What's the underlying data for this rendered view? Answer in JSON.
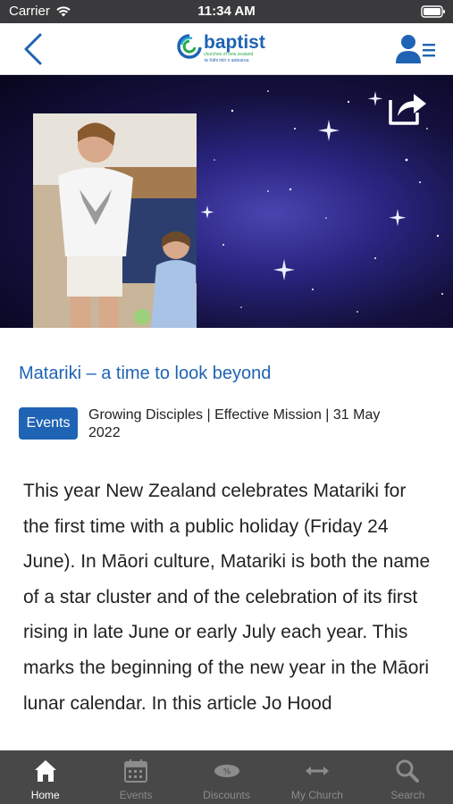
{
  "status_bar": {
    "carrier": "Carrier",
    "time": "11:34 AM",
    "icons": [
      "wifi-icon",
      "battery-icon"
    ]
  },
  "nav": {
    "back_icon": "chevron-left-icon",
    "logo_text": "baptist",
    "logo_subtext": "churches of new zealand",
    "logo_tagline": "te hāhi iriiri o aotearoa",
    "profile_icon": "profile-menu-icon",
    "accent_color": "#1f63b4"
  },
  "hero": {
    "share_icon": "share-icon",
    "photo_icon": "hero-photo"
  },
  "article": {
    "title": "Matariki – a time to look beyond",
    "category": "Events",
    "meta": "Growing Disciples | Effective Mission | 31 May 2022",
    "body": "This year New Zealand celebrates Matariki for the first time with a public holiday (Friday 24 June). In Māori culture, Matariki is both the name of a star cluster and of the celebration of its first rising in late June or early July each year. This marks the beginning of the new year in the Māori lunar calendar. In this article Jo Hood"
  },
  "tabs": [
    {
      "label": "Home",
      "icon": "home-icon",
      "active": true
    },
    {
      "label": "Events",
      "icon": "calendar-icon",
      "active": false
    },
    {
      "label": "Discounts",
      "icon": "discount-icon",
      "active": false
    },
    {
      "label": "My Church",
      "icon": "arrows-icon",
      "active": false
    },
    {
      "label": "Search",
      "icon": "search-icon",
      "active": false
    }
  ]
}
